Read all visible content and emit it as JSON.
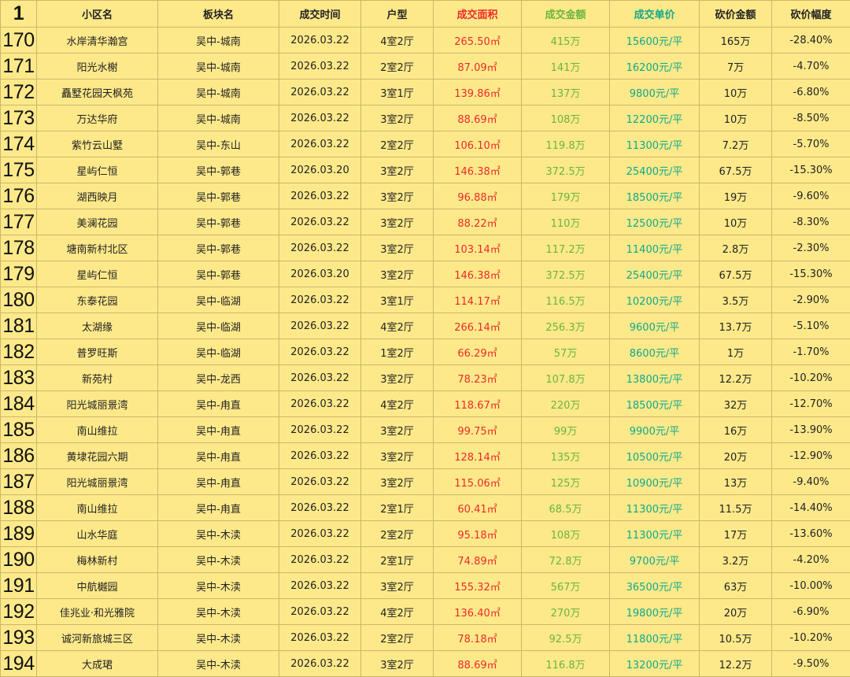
{
  "corner_label": "1",
  "headers": [
    "小区名",
    "板块名",
    "成交时间",
    "户型",
    "成交面积",
    "成交金额",
    "成交单价",
    "砍价金额",
    "砍价幅度"
  ],
  "colors": {
    "area": "#f02a2a",
    "amount": "#6cb33f",
    "unit": "#11a88a",
    "background": "#fde98a"
  },
  "rows": [
    {
      "n": "170",
      "name": "水岸清华瀚宫",
      "district": "吴中-城南",
      "date": "2026.03.22",
      "layout": "4室2厅",
      "area": "265.50㎡",
      "amount": "415万",
      "unit": "15600元/平",
      "cut": "165万",
      "pct": "-28.40%"
    },
    {
      "n": "171",
      "name": "阳光水榭",
      "district": "吴中-城南",
      "date": "2026.03.22",
      "layout": "2室2厅",
      "area": "87.09㎡",
      "amount": "141万",
      "unit": "16200元/平",
      "cut": "7万",
      "pct": "-4.70%"
    },
    {
      "n": "172",
      "name": "矗墅花园天枫苑",
      "district": "吴中-城南",
      "date": "2026.03.22",
      "layout": "3室1厅",
      "area": "139.86㎡",
      "amount": "137万",
      "unit": "9800元/平",
      "cut": "10万",
      "pct": "-6.80%"
    },
    {
      "n": "173",
      "name": "万达华府",
      "district": "吴中-城南",
      "date": "2026.03.22",
      "layout": "3室2厅",
      "area": "88.69㎡",
      "amount": "108万",
      "unit": "12200元/平",
      "cut": "10万",
      "pct": "-8.50%"
    },
    {
      "n": "174",
      "name": "紫竹云山墅",
      "district": "吴中-东山",
      "date": "2026.03.22",
      "layout": "2室2厅",
      "area": "106.10㎡",
      "amount": "119.8万",
      "unit": "11300元/平",
      "cut": "7.2万",
      "pct": "-5.70%"
    },
    {
      "n": "175",
      "name": "星屿仁恒",
      "district": "吴中-郭巷",
      "date": "2026.03.20",
      "layout": "3室2厅",
      "area": "146.38㎡",
      "amount": "372.5万",
      "unit": "25400元/平",
      "cut": "67.5万",
      "pct": "-15.30%"
    },
    {
      "n": "176",
      "name": "湖西映月",
      "district": "吴中-郭巷",
      "date": "2026.03.22",
      "layout": "3室2厅",
      "area": "96.88㎡",
      "amount": "179万",
      "unit": "18500元/平",
      "cut": "19万",
      "pct": "-9.60%"
    },
    {
      "n": "177",
      "name": "美澜花园",
      "district": "吴中-郭巷",
      "date": "2026.03.22",
      "layout": "3室2厅",
      "area": "88.22㎡",
      "amount": "110万",
      "unit": "12500元/平",
      "cut": "10万",
      "pct": "-8.30%"
    },
    {
      "n": "178",
      "name": "塘南新村北区",
      "district": "吴中-郭巷",
      "date": "2026.03.22",
      "layout": "3室2厅",
      "area": "103.14㎡",
      "amount": "117.2万",
      "unit": "11400元/平",
      "cut": "2.8万",
      "pct": "-2.30%"
    },
    {
      "n": "179",
      "name": "星屿仁恒",
      "district": "吴中-郭巷",
      "date": "2026.03.20",
      "layout": "3室2厅",
      "area": "146.38㎡",
      "amount": "372.5万",
      "unit": "25400元/平",
      "cut": "67.5万",
      "pct": "-15.30%"
    },
    {
      "n": "180",
      "name": "东泰花园",
      "district": "吴中-临湖",
      "date": "2026.03.22",
      "layout": "3室1厅",
      "area": "114.17㎡",
      "amount": "116.5万",
      "unit": "10200元/平",
      "cut": "3.5万",
      "pct": "-2.90%"
    },
    {
      "n": "181",
      "name": "太湖缘",
      "district": "吴中-临湖",
      "date": "2026.03.22",
      "layout": "4室2厅",
      "area": "266.14㎡",
      "amount": "256.3万",
      "unit": "9600元/平",
      "cut": "13.7万",
      "pct": "-5.10%"
    },
    {
      "n": "182",
      "name": "普罗旺斯",
      "district": "吴中-临湖",
      "date": "2026.03.22",
      "layout": "1室2厅",
      "area": "66.29㎡",
      "amount": "57万",
      "unit": "8600元/平",
      "cut": "1万",
      "pct": "-1.70%"
    },
    {
      "n": "183",
      "name": "新苑村",
      "district": "吴中-龙西",
      "date": "2026.03.22",
      "layout": "3室2厅",
      "area": "78.23㎡",
      "amount": "107.8万",
      "unit": "13800元/平",
      "cut": "12.2万",
      "pct": "-10.20%"
    },
    {
      "n": "184",
      "name": "阳光城丽景湾",
      "district": "吴中-甪直",
      "date": "2026.03.22",
      "layout": "4室2厅",
      "area": "118.67㎡",
      "amount": "220万",
      "unit": "18500元/平",
      "cut": "32万",
      "pct": "-12.70%"
    },
    {
      "n": "185",
      "name": "南山维拉",
      "district": "吴中-甪直",
      "date": "2026.03.22",
      "layout": "3室2厅",
      "area": "99.75㎡",
      "amount": "99万",
      "unit": "9900元/平",
      "cut": "16万",
      "pct": "-13.90%"
    },
    {
      "n": "186",
      "name": "黄埭花园六期",
      "district": "吴中-甪直",
      "date": "2026.03.22",
      "layout": "3室2厅",
      "area": "128.14㎡",
      "amount": "135万",
      "unit": "10500元/平",
      "cut": "20万",
      "pct": "-12.90%"
    },
    {
      "n": "187",
      "name": "阳光城丽景湾",
      "district": "吴中-甪直",
      "date": "2026.03.22",
      "layout": "3室2厅",
      "area": "115.06㎡",
      "amount": "125万",
      "unit": "10900元/平",
      "cut": "13万",
      "pct": "-9.40%"
    },
    {
      "n": "188",
      "name": "南山维拉",
      "district": "吴中-甪直",
      "date": "2026.03.22",
      "layout": "2室1厅",
      "area": "60.41㎡",
      "amount": "68.5万",
      "unit": "11300元/平",
      "cut": "11.5万",
      "pct": "-14.40%"
    },
    {
      "n": "189",
      "name": "山水华庭",
      "district": "吴中-木渎",
      "date": "2026.03.22",
      "layout": "2室2厅",
      "area": "95.18㎡",
      "amount": "108万",
      "unit": "11300元/平",
      "cut": "17万",
      "pct": "-13.60%"
    },
    {
      "n": "190",
      "name": "梅林新村",
      "district": "吴中-木渎",
      "date": "2026.03.22",
      "layout": "2室1厅",
      "area": "74.89㎡",
      "amount": "72.8万",
      "unit": "9700元/平",
      "cut": "3.2万",
      "pct": "-4.20%"
    },
    {
      "n": "191",
      "name": "中航樾园",
      "district": "吴中-木渎",
      "date": "2026.03.22",
      "layout": "3室2厅",
      "area": "155.32㎡",
      "amount": "567万",
      "unit": "36500元/平",
      "cut": "63万",
      "pct": "-10.00%"
    },
    {
      "n": "192",
      "name": "佳兆业·和光雅院",
      "district": "吴中-木渎",
      "date": "2026.03.22",
      "layout": "4室2厅",
      "area": "136.40㎡",
      "amount": "270万",
      "unit": "19800元/平",
      "cut": "20万",
      "pct": "-6.90%"
    },
    {
      "n": "193",
      "name": "诚河新旅城三区",
      "district": "吴中-木渎",
      "date": "2026.03.22",
      "layout": "2室2厅",
      "area": "78.18㎡",
      "amount": "92.5万",
      "unit": "11800元/平",
      "cut": "10.5万",
      "pct": "-10.20%"
    },
    {
      "n": "194",
      "name": "大成珺",
      "district": "吴中-木渎",
      "date": "2026.03.22",
      "layout": "3室2厅",
      "area": "88.69㎡",
      "amount": "116.8万",
      "unit": "13200元/平",
      "cut": "12.2万",
      "pct": "-9.50%"
    }
  ]
}
